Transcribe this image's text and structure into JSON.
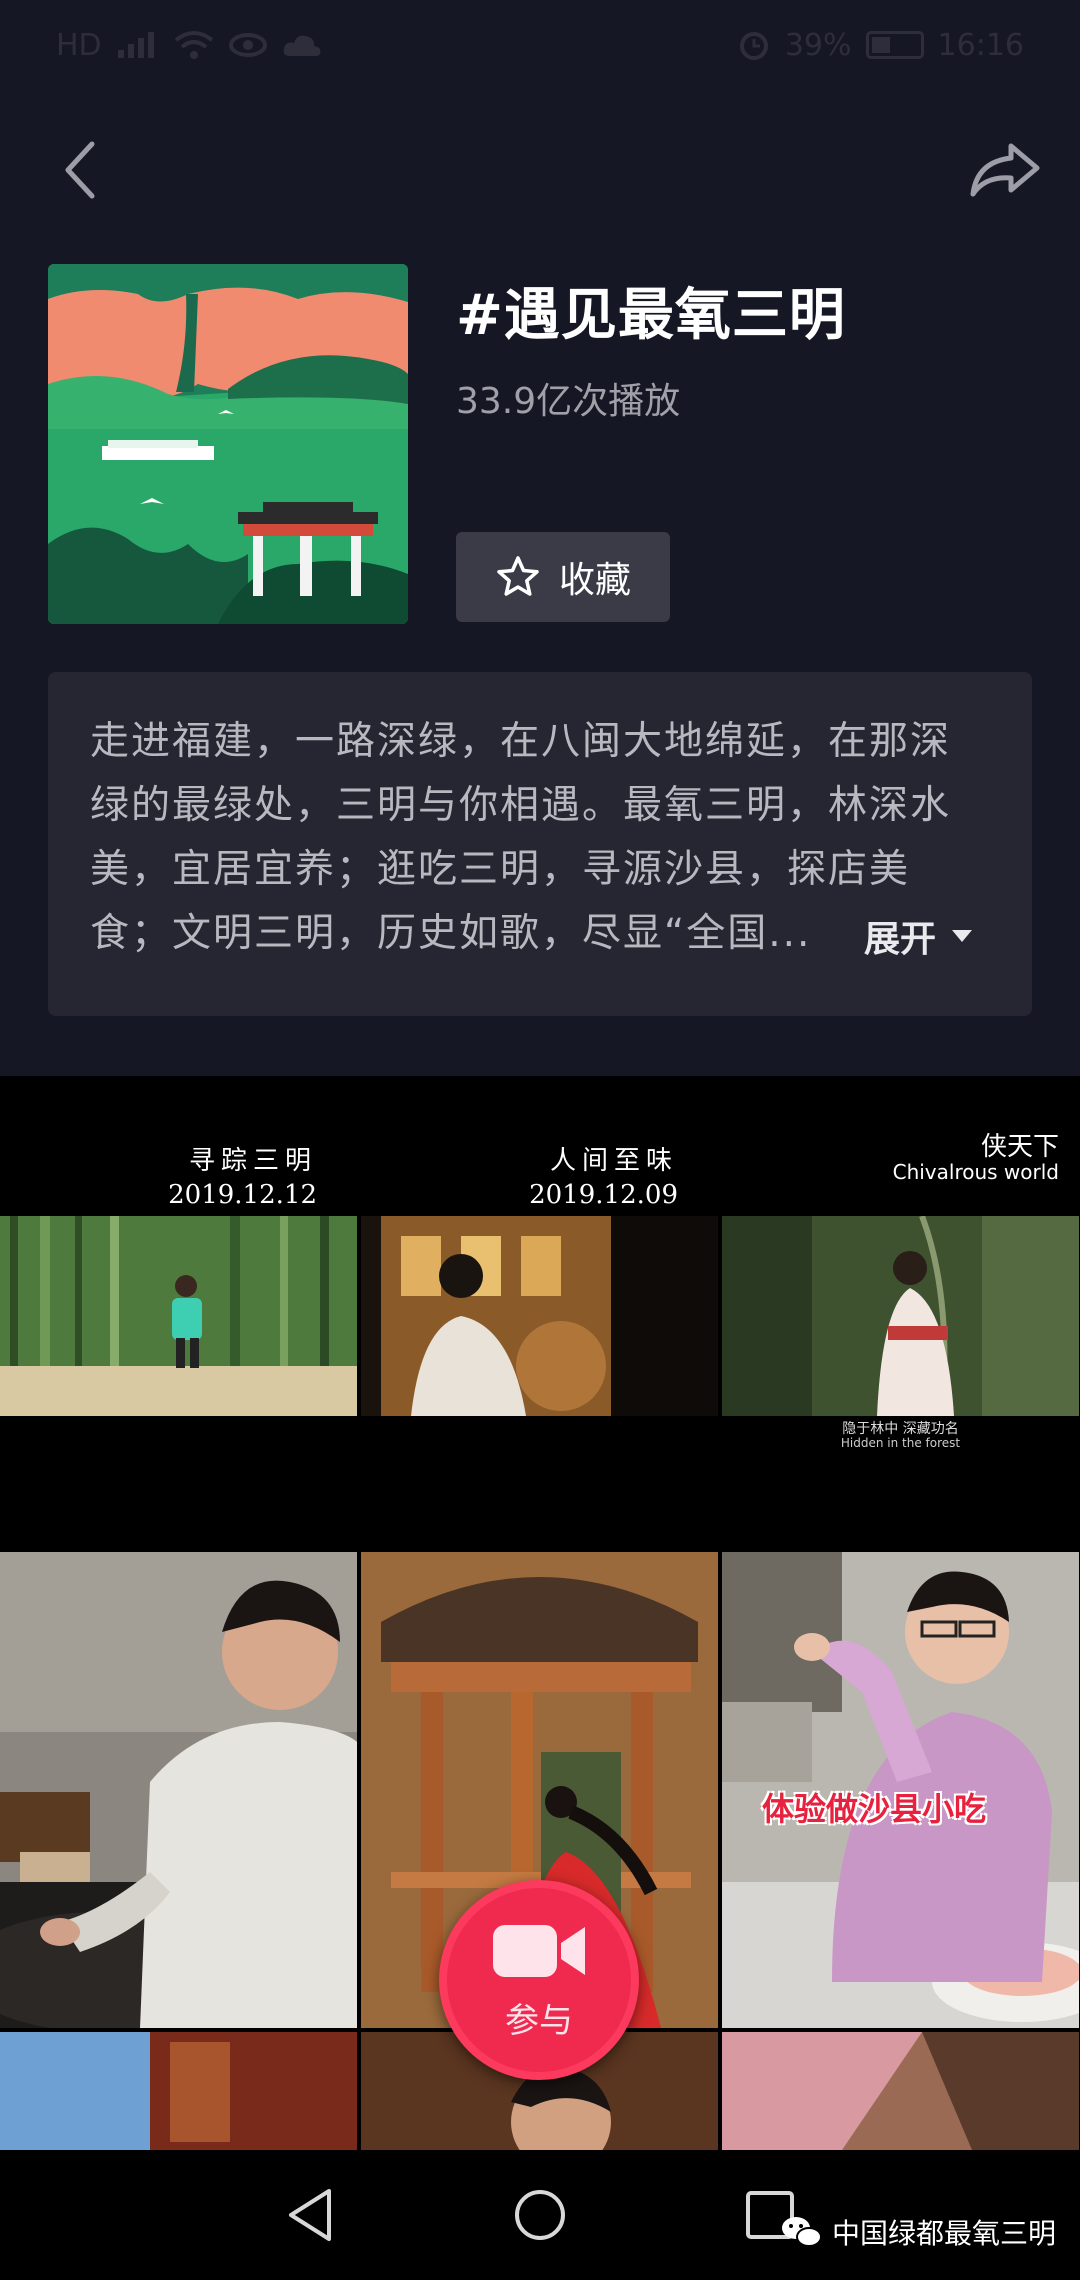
{
  "status_bar": {
    "left_icons": [
      "hd-icon",
      "signal-icon",
      "wifi-icon",
      "eye-icon",
      "cloud-icon"
    ],
    "hd_label": "HD",
    "battery_percent": "39%",
    "time": "16:16"
  },
  "topic": {
    "title": "#遇见最氧三明",
    "play_count": "33.9亿次播放",
    "collect_label": "收藏"
  },
  "description": {
    "text": "走进福建，一路深绿，在八闽大地绵延，在那深绿的最绿处，三明与你相遇。最氧三明，林深水美，宜居宜养；逛吃三明，寻源沙县，探店美食；文明三明，历史如歌，尽显“全国...",
    "expand_label": "展开"
  },
  "videos": [
    {
      "caption_cn": "寻踪三明",
      "caption_date": "2019.12.12"
    },
    {
      "caption_cn": "人间至味",
      "caption_date": "2019.12.09"
    },
    {
      "caption_cn": "侠天下",
      "caption_en": "Chivalrous world",
      "subtitle_cn": "隐于林中 深藏功名",
      "subtitle_en": "Hidden in the forest"
    },
    {},
    {},
    {
      "overlay_text": "体验做沙县小吃"
    }
  ],
  "participate": {
    "label": "参与"
  },
  "watermark": {
    "text": "中国绿都最氧三明"
  },
  "colors": {
    "background": "#161724",
    "accent": "#f0294f",
    "panel": "#252631",
    "overlay_red": "#e8213e"
  }
}
